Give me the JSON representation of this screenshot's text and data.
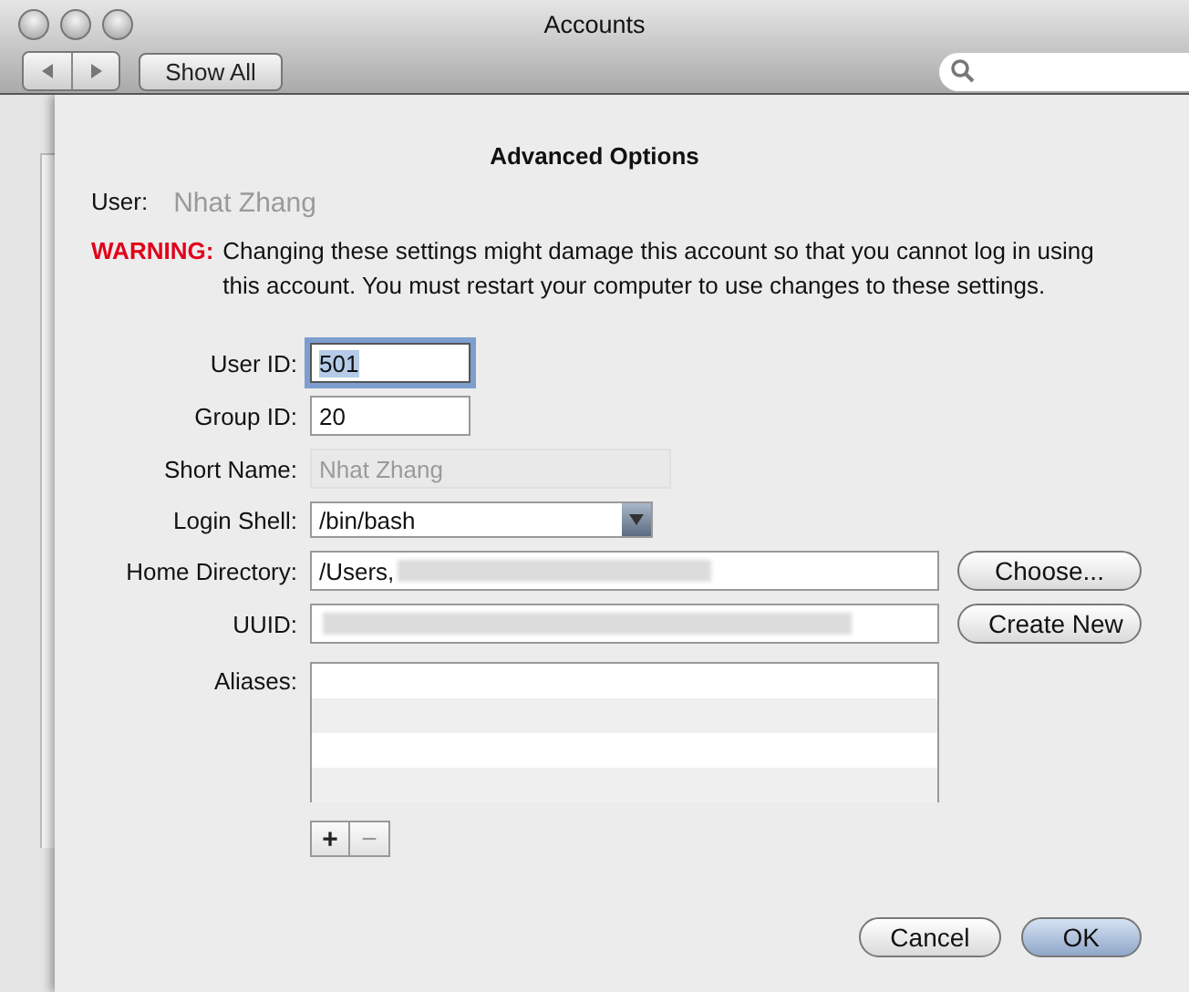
{
  "window": {
    "title": "Accounts",
    "toolbar": {
      "show_all": "Show All"
    }
  },
  "sheet": {
    "title": "Advanced Options",
    "user": {
      "label": "User:",
      "value": "Nhat Zhang"
    },
    "warning": {
      "label": "WARNING:",
      "text": "Changing these settings might damage this account so that you cannot log in using this account. You must restart your computer to use changes to these settings."
    },
    "fields": [
      {
        "kind": "text",
        "label": "User ID:",
        "value": "501",
        "focused": true,
        "disabled": false,
        "redacted": false
      },
      {
        "kind": "text",
        "label": "Group ID:",
        "value": "20",
        "focused": false,
        "disabled": false,
        "redacted": false
      },
      {
        "kind": "text",
        "label": "Short Name:",
        "value": "Nhat Zhang",
        "focused": false,
        "disabled": true,
        "redacted": false
      },
      {
        "kind": "select",
        "label": "Login Shell:",
        "value": "/bin/bash"
      },
      {
        "kind": "text",
        "label": "Home Directory:",
        "value": "/Users,",
        "focused": false,
        "disabled": false,
        "redacted": true,
        "button": "Choose..."
      },
      {
        "kind": "text",
        "label": "UUID:",
        "focused": false,
        "disabled": false,
        "redacted": true,
        "button": "Create New"
      },
      {
        "kind": "list",
        "label": "Aliases:"
      }
    ],
    "list_buttons": [
      "+",
      "−"
    ],
    "buttons": [
      {
        "label": "Cancel",
        "default": false
      },
      {
        "label": "OK",
        "default": true
      }
    ]
  }
}
